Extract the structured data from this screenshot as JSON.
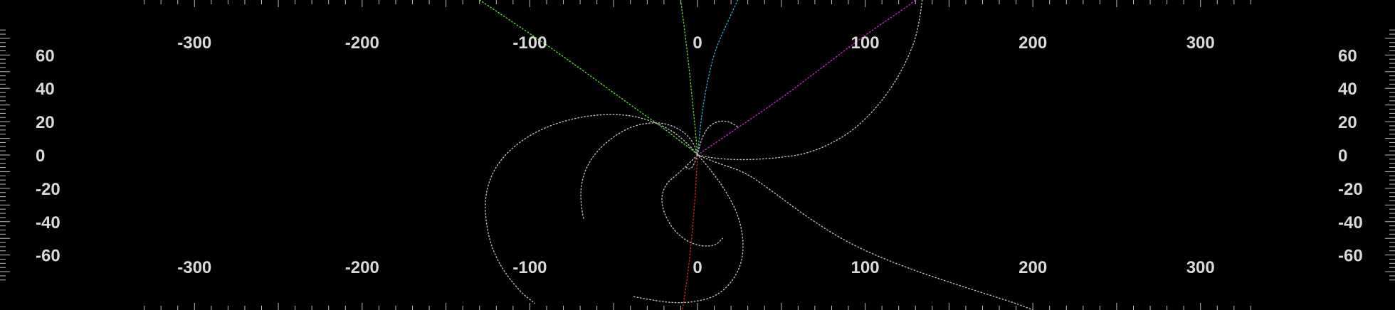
{
  "chart_data": {
    "type": "scatter",
    "title": "",
    "xlabel": "",
    "ylabel": "",
    "grid": false,
    "legend": "none",
    "background": "#000000",
    "xlim": [
      -416,
      416
    ],
    "ylim": [
      -93,
      93
    ],
    "x_tick_labels": [
      "-300",
      "-200",
      "-100",
      "0",
      "100",
      "200",
      "300"
    ],
    "x_tick_values": [
      -300,
      -200,
      -100,
      0,
      100,
      200,
      300
    ],
    "y_tick_labels": [
      "60",
      "40",
      "20",
      "0",
      "-20",
      "-40",
      "-60"
    ],
    "y_tick_values": [
      60,
      40,
      20,
      0,
      -20,
      -40,
      -60
    ],
    "series": [
      {
        "color": "#55dd22",
        "style": "dotted",
        "points": [
          [
            -130,
            93
          ],
          [
            -100,
            73
          ],
          [
            -70,
            52
          ],
          [
            -40,
            30
          ],
          [
            -20,
            16
          ],
          [
            -10,
            8
          ],
          [
            -3,
            3
          ],
          [
            0,
            0
          ]
        ]
      },
      {
        "color": "#66cc22",
        "style": "dotted",
        "points": [
          [
            -10,
            93
          ],
          [
            -6,
            62
          ],
          [
            -3,
            32
          ],
          [
            -1,
            12
          ],
          [
            0,
            0
          ]
        ]
      },
      {
        "color": "#22aacc",
        "style": "dotted",
        "points": [
          [
            24,
            93
          ],
          [
            18,
            80
          ],
          [
            10,
            62
          ],
          [
            5,
            40
          ],
          [
            2,
            20
          ],
          [
            0.5,
            5
          ],
          [
            0,
            0
          ]
        ]
      },
      {
        "color": "#cc22cc",
        "style": "dotted",
        "points": [
          [
            0,
            0
          ],
          [
            25,
            17
          ],
          [
            50,
            34
          ],
          [
            75,
            53
          ],
          [
            100,
            72
          ],
          [
            125,
            89
          ],
          [
            130,
            93
          ]
        ]
      },
      {
        "color": "#cc2222",
        "style": "dotted",
        "points": [
          [
            0,
            0
          ],
          [
            -1,
            -20
          ],
          [
            -3,
            -45
          ],
          [
            -5,
            -65
          ],
          [
            -7,
            -80
          ],
          [
            -9,
            -93
          ]
        ]
      },
      {
        "color": "#bbbbbb",
        "style": "dotted",
        "points": [
          [
            134,
            93
          ],
          [
            132,
            76
          ],
          [
            126,
            59
          ],
          [
            117,
            42
          ],
          [
            104,
            25
          ],
          [
            88,
            11
          ],
          [
            67,
            1
          ],
          [
            46,
            -2
          ],
          [
            26,
            -3
          ],
          [
            10,
            -2
          ],
          [
            0,
            0
          ]
        ]
      },
      {
        "color": "#bbbbbb",
        "style": "dotted",
        "points": [
          [
            -68,
            -38
          ],
          [
            -70,
            -28
          ],
          [
            -69,
            -14
          ],
          [
            -63,
            -1
          ],
          [
            -52,
            10
          ],
          [
            -38,
            18
          ],
          [
            -22,
            20
          ],
          [
            -9,
            15
          ],
          [
            -2,
            7
          ],
          [
            0,
            0
          ]
        ]
      },
      {
        "color": "#bbbbbb",
        "style": "dotted",
        "points": [
          [
            -38,
            -85
          ],
          [
            -23,
            -88
          ],
          [
            -6,
            -89
          ],
          [
            12,
            -85
          ],
          [
            24,
            -72
          ],
          [
            28,
            -56
          ],
          [
            25,
            -37
          ],
          [
            16,
            -20
          ],
          [
            7,
            -8
          ],
          [
            2,
            -2
          ],
          [
            0,
            0
          ]
        ]
      },
      {
        "color": "#bbbbbb",
        "style": "dotted",
        "points": [
          [
            0,
            0
          ],
          [
            -8,
            10
          ],
          [
            -25,
            20
          ],
          [
            -45,
            25
          ],
          [
            -72,
            23
          ],
          [
            -98,
            14
          ],
          [
            -118,
            -2
          ],
          [
            -127,
            -22
          ],
          [
            -126,
            -45
          ],
          [
            -119,
            -65
          ],
          [
            -106,
            -82
          ],
          [
            -97,
            -89
          ]
        ]
      },
      {
        "color": "#bbbbbb",
        "style": "dotted",
        "points": [
          [
            0,
            0
          ],
          [
            12,
            -5
          ],
          [
            28,
            -10
          ],
          [
            45,
            -22
          ],
          [
            65,
            -37
          ],
          [
            90,
            -53
          ],
          [
            120,
            -66
          ],
          [
            155,
            -78
          ],
          [
            190,
            -89
          ],
          [
            200,
            -93
          ]
        ]
      },
      {
        "color": "#bbbbbb",
        "style": "dotted",
        "points": [
          [
            0,
            0
          ],
          [
            2,
            10
          ],
          [
            8,
            19
          ],
          [
            17,
            21
          ],
          [
            24,
            17
          ]
        ]
      },
      {
        "color": "#bbbbbb",
        "style": "dotted",
        "points": [
          [
            0,
            0
          ],
          [
            -10,
            -10
          ],
          [
            -20,
            -18
          ],
          [
            -22,
            -30
          ],
          [
            -15,
            -45
          ],
          [
            -3,
            -54
          ],
          [
            10,
            -55
          ],
          [
            15,
            -50
          ]
        ]
      },
      {
        "color": "#bbbbbb",
        "style": "dotted",
        "points": [
          [
            0,
            0
          ],
          [
            -2,
            -6
          ],
          [
            -5,
            -9
          ],
          [
            -7,
            -7
          ]
        ]
      }
    ]
  }
}
